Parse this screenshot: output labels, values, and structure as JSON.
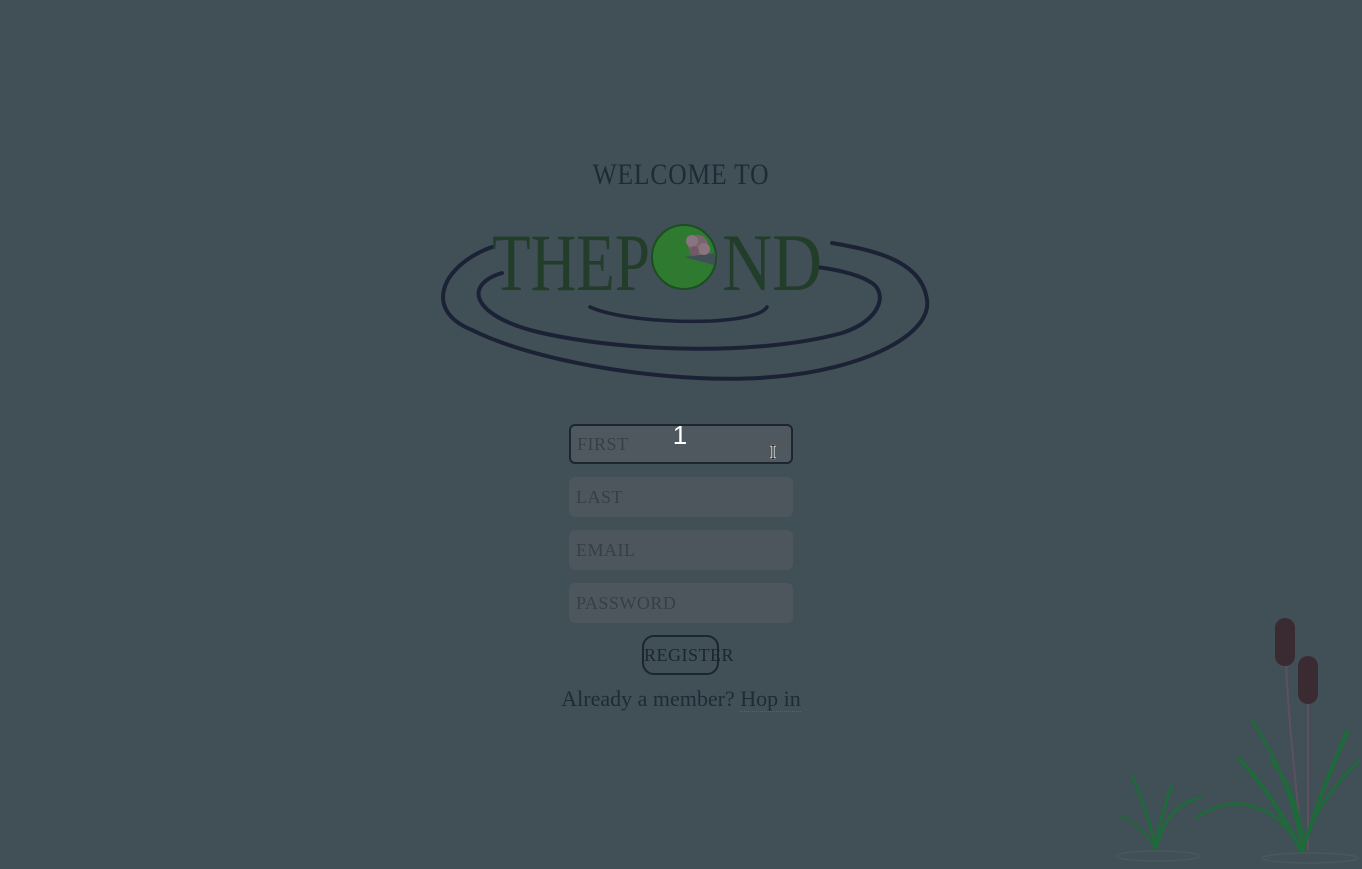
{
  "welcome": {
    "title": "WELCOME TO"
  },
  "logo": {
    "text_left": "THEP",
    "text_right": "ND",
    "icon": "lily-pad-icon"
  },
  "form": {
    "first_placeholder": "FIRST",
    "last_placeholder": "LAST",
    "email_placeholder": "EMAIL",
    "password_placeholder": "PASSWORD",
    "register_label": "REGISTER"
  },
  "overlay": {
    "count": "1",
    "cursor_icon": "text-cursor-icon"
  },
  "footer": {
    "prompt": "Already a member?",
    "link": "Hop in"
  },
  "decor": {
    "reeds_icon": "cattail-reeds-icon"
  },
  "colors": {
    "background": "#414f56",
    "ink": "#1d2833",
    "pad_green": "#2e7d32",
    "field_bg": "#4d565d"
  }
}
